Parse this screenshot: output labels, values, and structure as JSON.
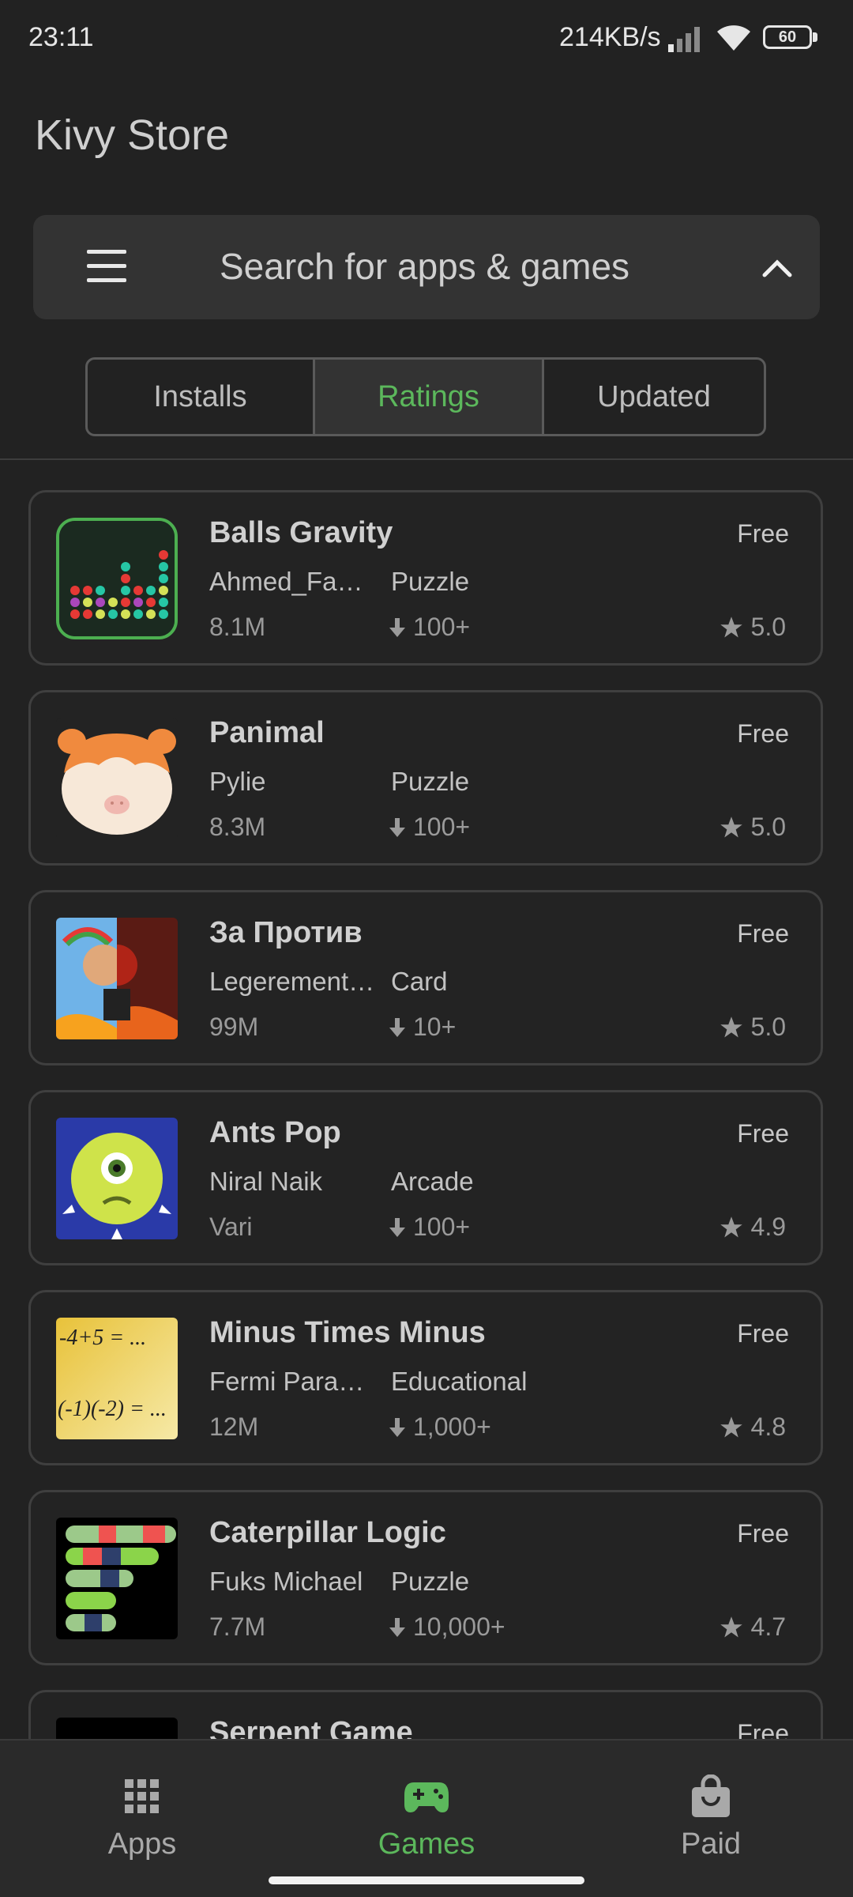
{
  "status": {
    "time": "23:11",
    "network_speed": "214KB/s",
    "battery": "60"
  },
  "app_title": "Kivy Store",
  "search": {
    "placeholder": "Search for apps & games"
  },
  "tabs": [
    {
      "label": "Installs",
      "selected": false
    },
    {
      "label": "Ratings",
      "selected": true
    },
    {
      "label": "Updated",
      "selected": false
    }
  ],
  "apps": [
    {
      "name": "Balls Gravity",
      "price": "Free",
      "developer": "Ahmed_Fawzy",
      "category": "Puzzle",
      "size": "8.1M",
      "downloads": "100+",
      "rating": "5.0"
    },
    {
      "name": "Panimal",
      "price": "Free",
      "developer": "Pylie",
      "category": "Puzzle",
      "size": "8.3M",
      "downloads": "100+",
      "rating": "5.0"
    },
    {
      "name": "За Против",
      "price": "Free",
      "developer": "Legerement ...",
      "category": "Card",
      "size": "99M",
      "downloads": "10+",
      "rating": "5.0"
    },
    {
      "name": "Ants Pop",
      "price": "Free",
      "developer": "Niral Naik",
      "category": "Arcade",
      "size": "Vari",
      "downloads": "100+",
      "rating": "4.9"
    },
    {
      "name": "Minus Times Minus",
      "price": "Free",
      "developer": "Fermi Paradox",
      "category": "Educational",
      "size": "12M",
      "downloads": "1,000+",
      "rating": "4.8",
      "icon_text_1": "-4+5 = ...",
      "icon_text_2": "(-1)(-2) = ..."
    },
    {
      "name": "Caterpillar Logic",
      "price": "Free",
      "developer": "Fuks Michael",
      "category": "Puzzle",
      "size": "7.7M",
      "downloads": "10,000+",
      "rating": "4.7"
    },
    {
      "name": "Serpent Game",
      "price": "Free"
    }
  ],
  "bottom_nav": [
    {
      "label": "Apps",
      "icon": "grid-icon",
      "active": false
    },
    {
      "label": "Games",
      "icon": "gamepad-icon",
      "active": true
    },
    {
      "label": "Paid",
      "icon": "shopping-bag-icon",
      "active": false
    }
  ],
  "colors": {
    "accent": "#5cb85c",
    "background": "#222222",
    "card_border": "#3f3f3f"
  }
}
